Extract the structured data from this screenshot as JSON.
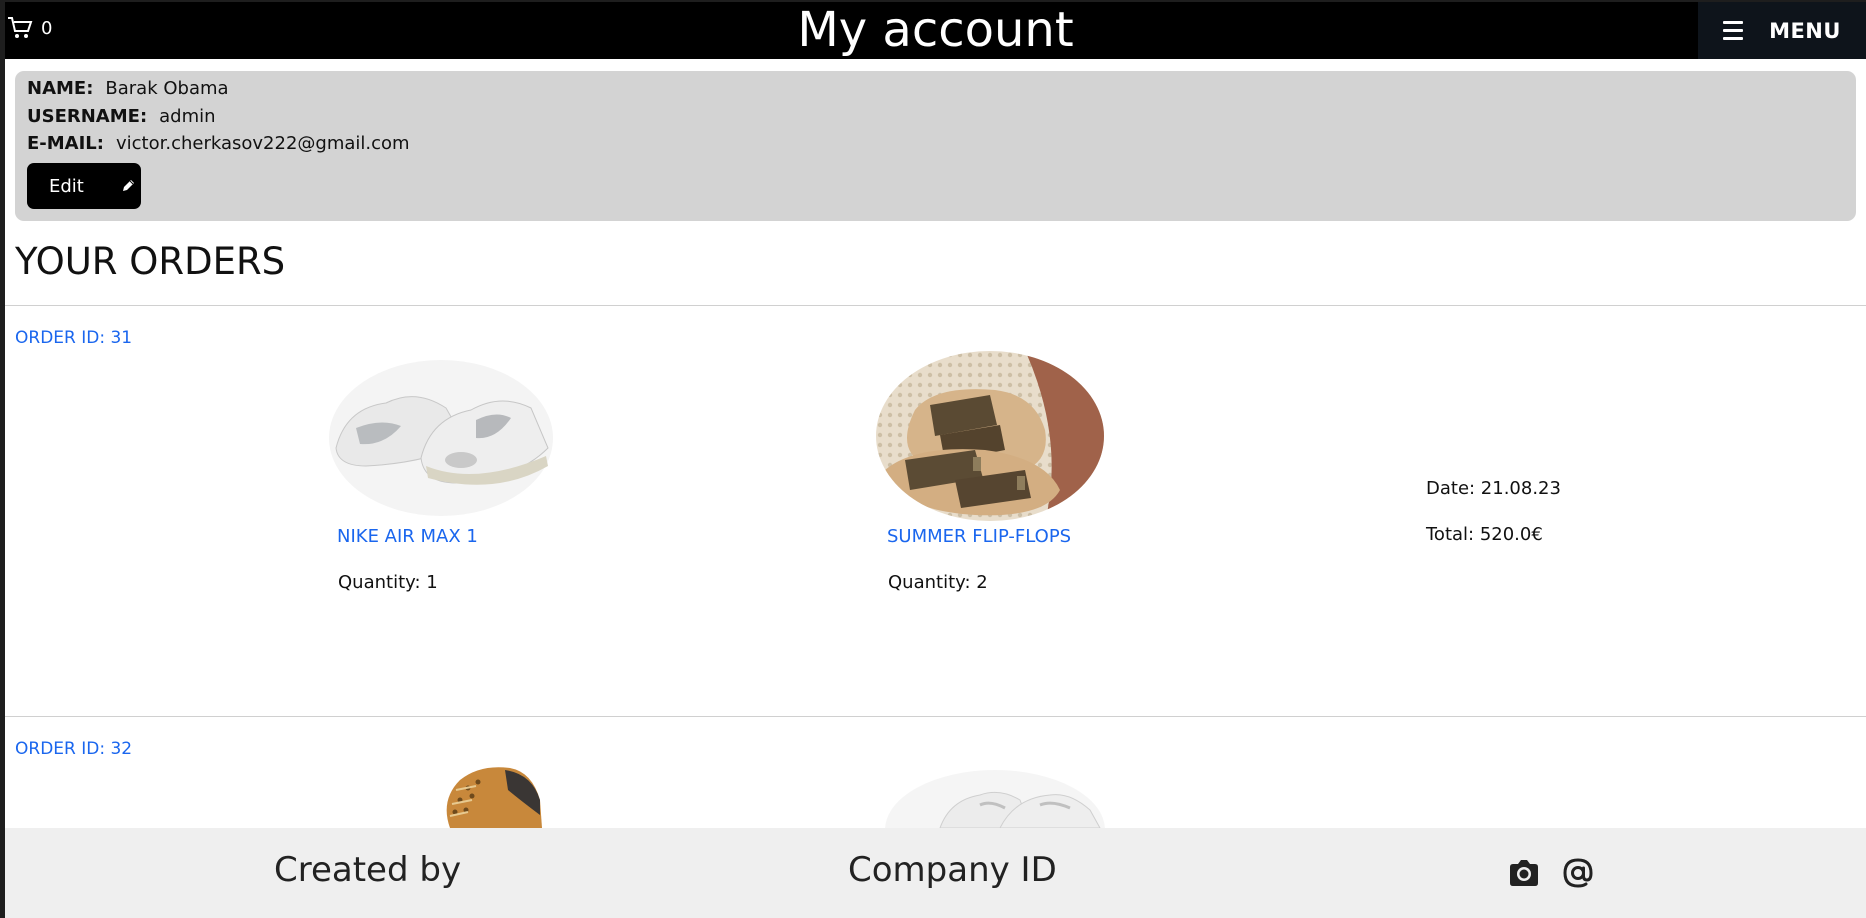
{
  "header": {
    "cart_count": "0",
    "title": "My account",
    "menu_label": "MENU"
  },
  "account": {
    "name_label": "NAME:",
    "name_value": "Barak Obama",
    "username_label": "USERNAME:",
    "username_value": "admin",
    "email_label": "E-MAIL:",
    "email_value": "victor.cherkasov222@gmail.com",
    "edit_label": "Edit"
  },
  "orders_title": "YOUR ORDERS",
  "orders": [
    {
      "id_label": "ORDER ID: 31",
      "items": [
        {
          "name": "NIKE AIR MAX 1",
          "quantity": "Quantity: 1",
          "image": "white-sneaker"
        },
        {
          "name": "SUMMER FLIP-FLOPS",
          "quantity": "Quantity: 2",
          "image": "brown-sandals"
        }
      ],
      "date": "Date: 21.08.23",
      "total": "Total: 520.0€"
    },
    {
      "id_label": "ORDER ID: 32",
      "items": [
        {
          "image": "tan-boot"
        },
        {
          "image": "white-sneaker"
        }
      ]
    }
  ],
  "footer": {
    "created_by": "Created by",
    "company_id": "Company ID",
    "icons": [
      "camera-icon",
      "at-icon"
    ]
  },
  "colors": {
    "header_bg": "#000000",
    "link": "#1a66ee",
    "panel_bg": "#d3d3d3",
    "footer_bg": "#efefef"
  }
}
